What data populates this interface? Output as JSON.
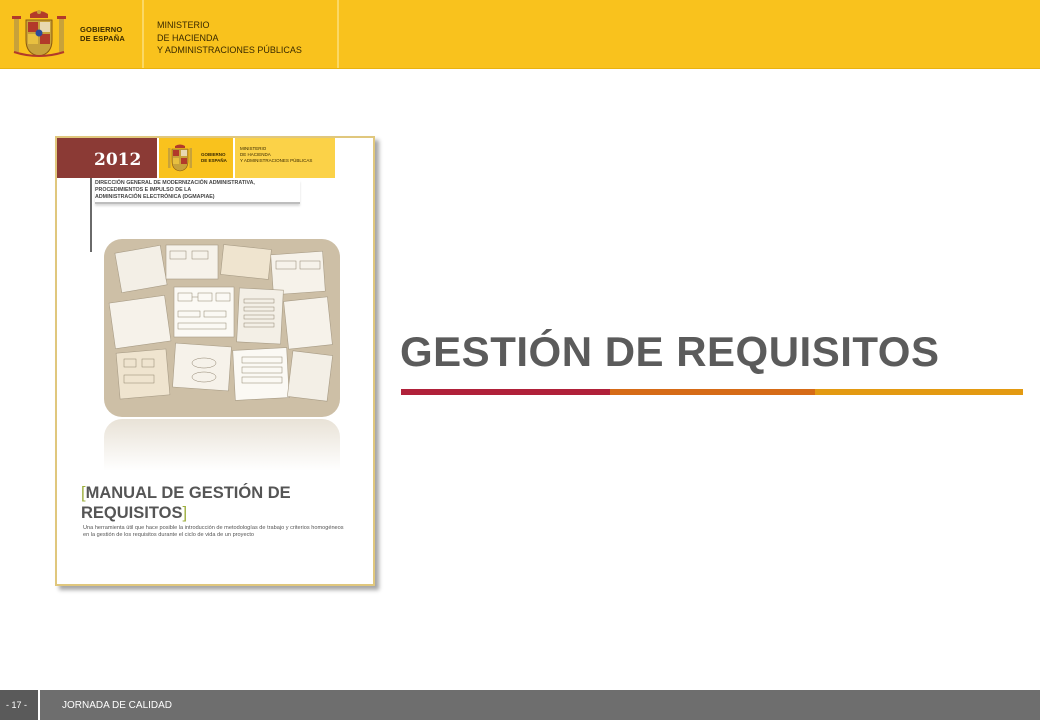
{
  "header": {
    "gobierno_line1": "GOBIERNO",
    "gobierno_line2": "DE ESPAÑA",
    "ministerio_lines": [
      "MINISTERIO",
      "DE HACIENDA",
      "Y ADMINISTRACIONES PÚBLICAS"
    ]
  },
  "cover": {
    "year": "2012",
    "gobierno_line1": "GOBIERNO",
    "gobierno_line2": "DE ESPAÑA",
    "ministerio_lines": [
      "MINISTERIO",
      "DE HACIENDA",
      "Y ADMINISTRACIONES PÚBLICAS"
    ],
    "direction_lines": [
      "DIRECCIÓN GENERAL DE MODERNIZACIÓN ADMINISTRATIVA,",
      "PROCEDIMIENTOS E IMPULSO DE LA",
      "ADMINISTRACIÓN ELECTRÓNICA (DGMAPIAE)"
    ],
    "title_open": "[",
    "title_line1": "MANUAL DE GESTIÓN DE",
    "title_line2": "REQUISITOS",
    "title_close": "]",
    "subtitle": "Una herramienta útil que hace posible la introducción de metodologías de trabajo y criterios homogéneos en la gestión de los requisitos durante el ciclo de vida de un proyecto"
  },
  "main": {
    "title": "GESTIÓN DE REQUISITOS"
  },
  "footer": {
    "page": "- 17 -",
    "event": "JORNADA DE CALIDAD"
  },
  "colors": {
    "header_yellow": "#f9c21d",
    "title_gray": "#5b5b5b",
    "underline_red": "#b0213a",
    "underline_orange": "#d66b17",
    "underline_amber": "#e39a12",
    "footer_gray": "#6e6e6e"
  }
}
